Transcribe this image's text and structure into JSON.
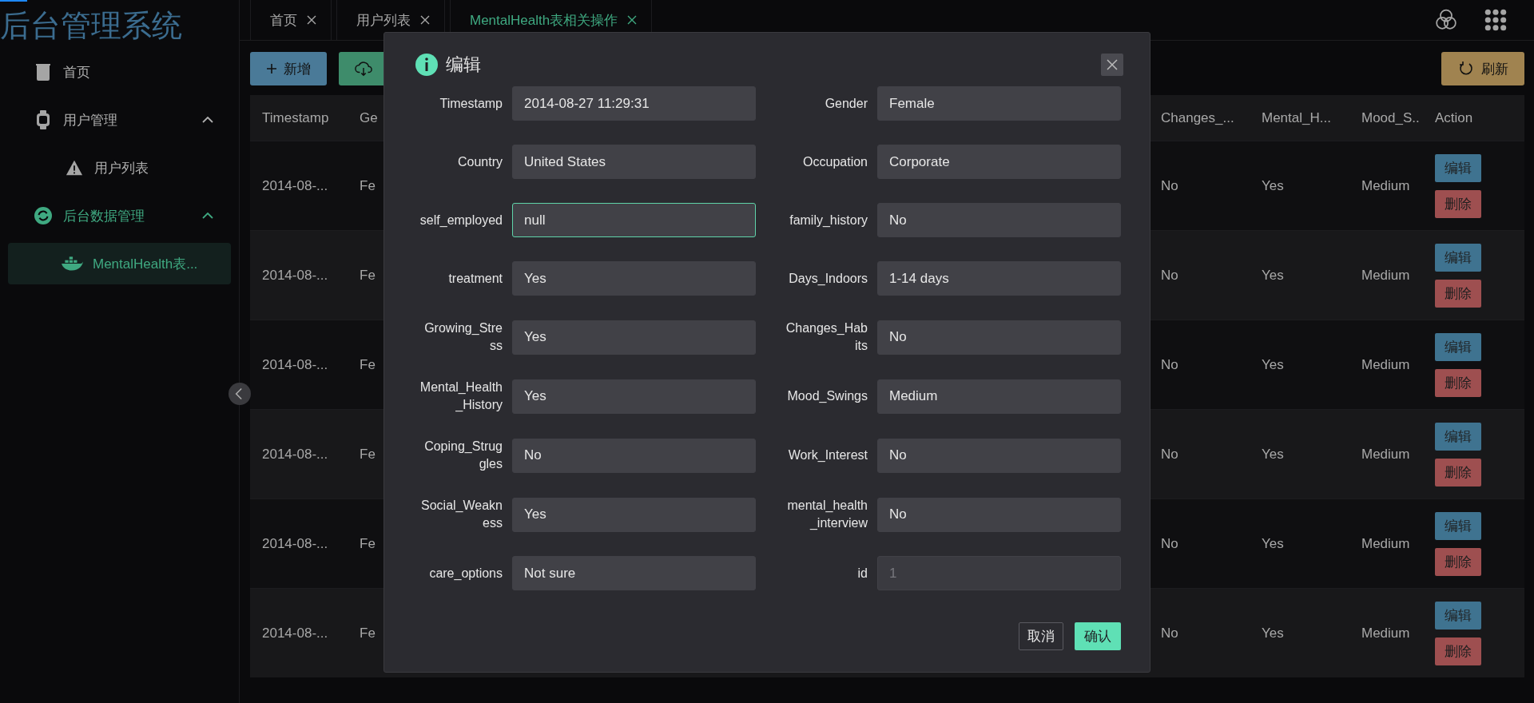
{
  "sidebar": {
    "title": "后台管理系统",
    "menu": [
      {
        "label": "首页",
        "selected": false
      },
      {
        "label": "用户管理",
        "selected": false,
        "expanded": true,
        "children": [
          {
            "label": "用户列表",
            "selected": false
          }
        ]
      },
      {
        "label": "后台数据管理",
        "selected": true,
        "expanded": true,
        "children": [
          {
            "label": "MentalHealth表...",
            "selected": true
          }
        ]
      }
    ]
  },
  "tabs": [
    {
      "label": "首页",
      "selected": false
    },
    {
      "label": "用户列表",
      "selected": false
    },
    {
      "label": "MentalHealth表相关操作",
      "selected": true
    }
  ],
  "toolbar": {
    "add_button": "新增",
    "refresh_button": "刷新"
  },
  "table": {
    "columns": [
      "Timestamp",
      "Ge",
      "Changes_...",
      "Mental_H...",
      "Mood_S..",
      "Action"
    ],
    "rows": [
      {
        "cells": [
          "2014-08-...",
          "Fe",
          "No",
          "Yes",
          "Medium"
        ],
        "actions": [
          "编辑",
          "删除"
        ]
      },
      {
        "cells": [
          "2014-08-...",
          "Fe",
          "No",
          "Yes",
          "Medium"
        ],
        "actions": [
          "编辑",
          "删除"
        ]
      },
      {
        "cells": [
          "2014-08-...",
          "Fe",
          "No",
          "Yes",
          "Medium"
        ],
        "actions": [
          "编辑",
          "删除"
        ]
      },
      {
        "cells": [
          "2014-08-...",
          "Fe",
          "No",
          "Yes",
          "Medium"
        ],
        "actions": [
          "编辑",
          "删除"
        ]
      },
      {
        "cells": [
          "2014-08-...",
          "Fe",
          "No",
          "Yes",
          "Medium"
        ],
        "actions": [
          "编辑",
          "删除"
        ]
      },
      {
        "cells": [
          "2014-08-...",
          "Fe",
          "No",
          "Yes",
          "Medium"
        ],
        "actions": [
          "编辑",
          "删除"
        ]
      }
    ]
  },
  "dialog": {
    "title": "编辑",
    "fields": [
      {
        "label": "Timestamp",
        "value": "2014-08-27 11:29:31",
        "focused": false,
        "disabled": false
      },
      {
        "label": "Gender",
        "value": "Female",
        "focused": false,
        "disabled": false
      },
      {
        "label": "Country",
        "value": "United States",
        "focused": false,
        "disabled": false
      },
      {
        "label": "Occupation",
        "value": "Corporate",
        "focused": false,
        "disabled": false
      },
      {
        "label": "self_employed",
        "value": "null",
        "focused": true,
        "disabled": false
      },
      {
        "label": "family_history",
        "value": "No",
        "focused": false,
        "disabled": false
      },
      {
        "label": "treatment",
        "value": "Yes",
        "focused": false,
        "disabled": false
      },
      {
        "label": "Days_Indoors",
        "value": "1-14 days",
        "focused": false,
        "disabled": false
      },
      {
        "label": "Growing_Stress",
        "value": "Yes",
        "focused": false,
        "disabled": false
      },
      {
        "label": "Changes_Habits",
        "value": "No",
        "focused": false,
        "disabled": false
      },
      {
        "label": "Mental_Health_History",
        "value": "Yes",
        "focused": false,
        "disabled": false
      },
      {
        "label": "Mood_Swings",
        "value": "Medium",
        "focused": false,
        "disabled": false
      },
      {
        "label": "Coping_Struggles",
        "value": "No",
        "focused": false,
        "disabled": false
      },
      {
        "label": "Work_Interest",
        "value": "No",
        "focused": false,
        "disabled": false
      },
      {
        "label": "Social_Weakness",
        "value": "Yes",
        "focused": false,
        "disabled": false
      },
      {
        "label": "mental_health_interview",
        "value": "No",
        "focused": false,
        "disabled": false
      },
      {
        "label": "care_options",
        "value": "Not sure",
        "focused": false,
        "disabled": false
      },
      {
        "label": "id",
        "value": "1",
        "focused": false,
        "disabled": true
      }
    ],
    "cancel_button": "取消",
    "confirm_button": "确认"
  }
}
